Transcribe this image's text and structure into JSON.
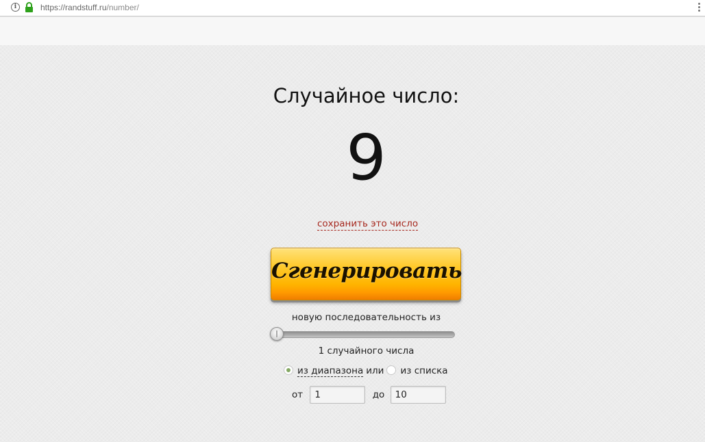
{
  "browser": {
    "url_host": "https://randstuff.ru",
    "url_path": "/number/",
    "colors": {
      "lock": "#2ea11b"
    }
  },
  "page": {
    "title": "Случайное число:",
    "result": "9",
    "save_link": "сохранить это число",
    "generate_button": "Сгенерировать",
    "sequence_label": "новую последовательность из",
    "slider": {
      "value": 1,
      "min": 1,
      "max": 100
    },
    "count_label": "1 случайного числа",
    "mode": {
      "range_label": "из диапазона",
      "or_text": "или",
      "list_label": "из списка",
      "selected": "range"
    },
    "range": {
      "from_label": "от",
      "from_value": "1",
      "to_label": "до",
      "to_value": "10"
    },
    "colors": {
      "save_link": "#a6271d",
      "button_top": "#ffe27a",
      "button_bottom": "#f07d00",
      "radio_selected": "#84a863"
    }
  }
}
